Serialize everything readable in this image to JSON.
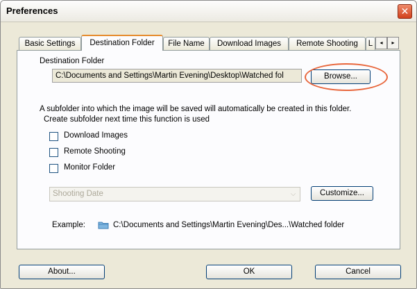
{
  "window": {
    "title": "Preferences",
    "close_glyph": "✕"
  },
  "tabs": [
    {
      "label": "Basic Settings",
      "active": false
    },
    {
      "label": "Destination Folder",
      "active": true
    },
    {
      "label": "File Name",
      "active": false
    },
    {
      "label": "Download Images",
      "active": false
    },
    {
      "label": "Remote Shooting",
      "active": false
    },
    {
      "label": "L",
      "active": false
    }
  ],
  "tab_scroll": {
    "left": "◂",
    "right": "▸"
  },
  "destination": {
    "label": "Destination Folder",
    "path": "C:\\Documents and Settings\\Martin Evening\\Desktop\\Watched fol",
    "browse_label": "Browse..."
  },
  "subfolder": {
    "description_line1": "A subfolder into which the image will be saved will automatically be created in this folder.",
    "description_line2": "Create subfolder next time this function is used",
    "options": [
      {
        "label": "Download Images",
        "checked": false
      },
      {
        "label": "Remote Shooting",
        "checked": false
      },
      {
        "label": "Monitor Folder",
        "checked": false
      }
    ],
    "naming_select": {
      "value": "Shooting Date",
      "enabled": false,
      "arrow": "⌵"
    },
    "customize_label": "Customize...",
    "example_label": "Example:",
    "example_path": "C:\\Documents and Settings\\Martin Evening\\Des...\\Watched folder"
  },
  "footer": {
    "about_label": "About...",
    "ok_label": "OK",
    "cancel_label": "Cancel"
  },
  "colors": {
    "accent_tab": "#e68b2c",
    "highlight_ring": "#e8653a",
    "close_button": "#d2401c"
  },
  "icons": {
    "close": "close-icon",
    "folder": "folder-icon"
  }
}
